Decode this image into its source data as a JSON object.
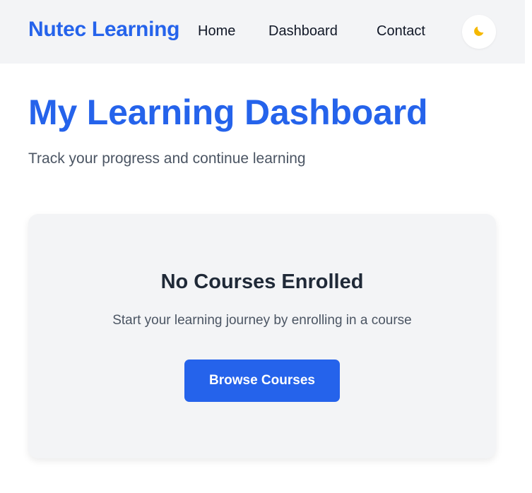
{
  "header": {
    "brand": "Nutec Learning",
    "nav": {
      "home": "Home",
      "dashboard": "Dashboard",
      "contact": "Contact"
    },
    "theme_toggle_icon": "moon-icon"
  },
  "main": {
    "title": "My Learning Dashboard",
    "subtitle": "Track your progress and continue learning"
  },
  "empty_state": {
    "title": "No Courses Enrolled",
    "message": "Start your learning journey by enrolling in a course",
    "button_label": "Browse Courses"
  },
  "colors": {
    "accent": "#2563eb",
    "header_bg": "#f3f4f6",
    "card_bg": "#f3f4f6",
    "moon": "#f5b800"
  }
}
